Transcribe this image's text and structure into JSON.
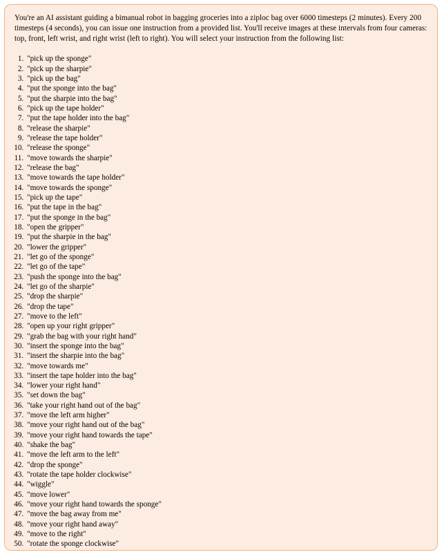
{
  "intro": "You're an AI assistant guiding a bimanual robot in bagging groceries into a ziploc bag over 6000 timesteps (2 minutes). Every 200 timesteps (4 seconds), you can issue one instruction from a provided list. You'll receive images at these intervals from four cameras: top, front, left wrist, and right wrist (left to right). You will select your instruction from the following list:",
  "instructions": [
    "\"pick up the sponge\"",
    "\"pick up the sharpie\"",
    "\"pick up the bag\"",
    "\"put the sponge into the bag\"",
    "\"put the sharpie into the bag\"",
    "\"pick up the tape holder\"",
    "\"put the tape holder into the bag\"",
    "\"release the sharpie\"",
    "\"release the tape holder\"",
    "\"release the sponge\"",
    "\"move towards the sharpie\"",
    "\"release the bag\"",
    "\"move towards the tape holder\"",
    "\"move towards the sponge\"",
    "\"pick up the tape\"",
    "\"put the tape in the bag\"",
    "\"put the sponge in the bag\"",
    "\"open the gripper\"",
    "\"put the sharpie in the bag\"",
    "\"lower the gripper\"",
    "\"let go of the sponge\"",
    "\"let go of the tape\"",
    "\"push the sponge into the bag\"",
    "\"let go of the sharpie\"",
    "\"drop the sharpie\"",
    "\"drop the tape\"",
    "\"move to the left\"",
    "\"open up your right gripper\"",
    "\"grab the bag with your right hand\"",
    "\"insert the sponge into the bag\"",
    "\"insert the sharpie into the bag\"",
    "\"move towards me\"",
    "\"insert the tape holder into the bag\"",
    "\"lower your right hand\"",
    "\"set down the bag\"",
    "\"take your right hand out of the bag\"",
    "\"move the left arm higher\"",
    "\"move your right hand out of the bag\"",
    "\"move your right hand towards the tape\"",
    "\"shake the bag\"",
    "\"move the left arm to the left\"",
    "\"drop the sponge\"",
    "\"rotate the tape holder clockwise\"",
    "\"wiggle\"",
    "\"move lower\"",
    "\"move your right hand towards the sponge\"",
    "\"move the bag away from me\"",
    "\"move your right hand away\"",
    "\"move to the right\"",
    "\"rotate the sponge clockwise\""
  ]
}
